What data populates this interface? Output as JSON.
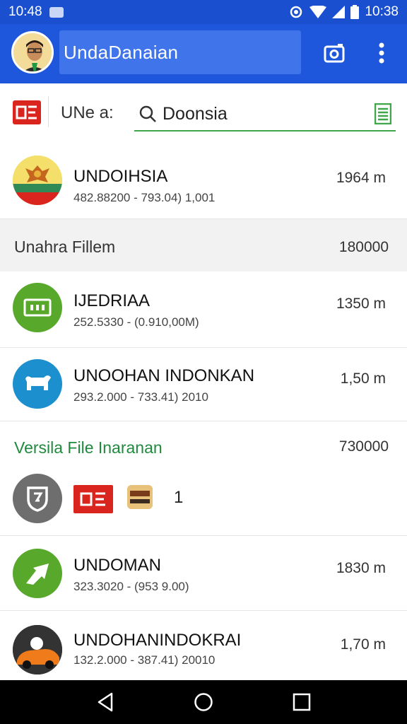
{
  "status_bar": {
    "time_left": "10:48",
    "time_right": "10:38",
    "icons": [
      "photo-icon",
      "eye-icon",
      "wifi-icon",
      "signal-icon",
      "battery-icon"
    ]
  },
  "app_bar": {
    "title": "UndaDanaian",
    "icons": [
      "camera-icon",
      "more-vert-icon"
    ]
  },
  "search_row": {
    "filter_label": "UNe a:",
    "search_value": "Doonsia",
    "icons": [
      "brand-badge-icon",
      "search-icon",
      "document-icon"
    ]
  },
  "list": {
    "top_item": {
      "name": "UNDOIHSIA",
      "sub": "482.88200 - 793.04) 1,001",
      "meta": "1964 m",
      "icon": "coat-of-arms-icon"
    },
    "section1": {
      "label": "Unahra Fillem",
      "count": "180000"
    },
    "items_a": [
      {
        "name": "IJEDRIAA",
        "sub": "252.5330 - (0.910,00M)",
        "meta": "1350 m",
        "icon": "ticket-icon",
        "color": "#58a82c"
      },
      {
        "name": "UNOOHAN INDONKAN",
        "sub": "293.2.000 - 733.41) 2010",
        "meta": "1,50 m",
        "icon": "dog-icon",
        "color": "#1c8fce"
      }
    ],
    "section2": {
      "label": "Versila File Inaranan",
      "count": "730000"
    },
    "chips": {
      "number": "1",
      "icons": [
        "shield-icon",
        "brand-badge-icon",
        "photo-thumb-icon"
      ]
    },
    "items_b": [
      {
        "name": "UNDOMAN",
        "sub": "323.3020 - (953 9.00)",
        "meta": "1830 m",
        "icon": "arrow-icon",
        "color": "#58a82c"
      },
      {
        "name": "UNDOHANINDOKRAI",
        "sub": "132.2.000 - 387.41) 20010",
        "meta": "1,70 m",
        "icon": "car-icon",
        "color": "#333333"
      }
    ]
  },
  "nav_bar": {
    "icons": [
      "back-icon",
      "home-icon",
      "recents-icon"
    ]
  },
  "colors": {
    "primary": "#1e56dc",
    "accent_green": "#3fa64a",
    "brand_red": "#d9251d"
  }
}
